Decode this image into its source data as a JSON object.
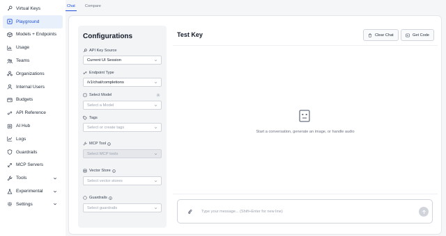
{
  "sidebar": {
    "items": [
      {
        "label": "Virtual Keys",
        "icon": "key-icon"
      },
      {
        "label": "Playground",
        "icon": "play-icon",
        "active": true
      },
      {
        "label": "Models + Endpoints",
        "icon": "cube-icon"
      },
      {
        "label": "Usage",
        "icon": "bar-chart-icon"
      },
      {
        "label": "Teams",
        "icon": "teams-icon"
      },
      {
        "label": "Organizations",
        "icon": "organization-icon"
      },
      {
        "label": "Internal Users",
        "icon": "user-icon"
      },
      {
        "label": "Budgets",
        "icon": "wallet-icon"
      },
      {
        "label": "API Reference",
        "icon": "api-icon"
      },
      {
        "label": "AI Hub",
        "icon": "hub-icon"
      },
      {
        "label": "Logs",
        "icon": "logs-icon"
      },
      {
        "label": "Guardrails",
        "icon": "shield-icon"
      },
      {
        "label": "MCP Servers",
        "icon": "server-icon"
      },
      {
        "label": "Tools",
        "icon": "tools-icon",
        "expandable": true
      },
      {
        "label": "Experimental",
        "icon": "flask-icon",
        "expandable": true
      },
      {
        "label": "Settings",
        "icon": "gear-icon",
        "expandable": true
      }
    ]
  },
  "tabs": [
    {
      "label": "Chat",
      "active": true
    },
    {
      "label": "Compare",
      "active": false
    }
  ],
  "config": {
    "title": "Configurations",
    "api_key_source": {
      "label": "API Key Source",
      "value": "Current UI Session"
    },
    "endpoint_type": {
      "label": "Endpoint Type",
      "value": "/v1/chat/completions"
    },
    "select_model": {
      "label": "Select Model",
      "placeholder": "Select a Model"
    },
    "tags": {
      "label": "Tags",
      "placeholder": "Select or create tags"
    },
    "mcp_tool": {
      "label": "MCP Tool",
      "placeholder": "Select MCP tools"
    },
    "vector_store": {
      "label": "Vector Store",
      "placeholder": "Select vector stores"
    },
    "guardrails": {
      "label": "Guardrails",
      "placeholder": "Select guardrails"
    }
  },
  "chat": {
    "title": "Test Key",
    "clear_label": "Clear Chat",
    "get_code_label": "Get Code",
    "empty_text": "Start a conversation, generate an image, or handle audio",
    "input_placeholder": "Type your message... (Shift+Enter for new line)"
  },
  "colors": {
    "accent": "#1d4ed8",
    "active_bg": "#e8f0fc"
  }
}
